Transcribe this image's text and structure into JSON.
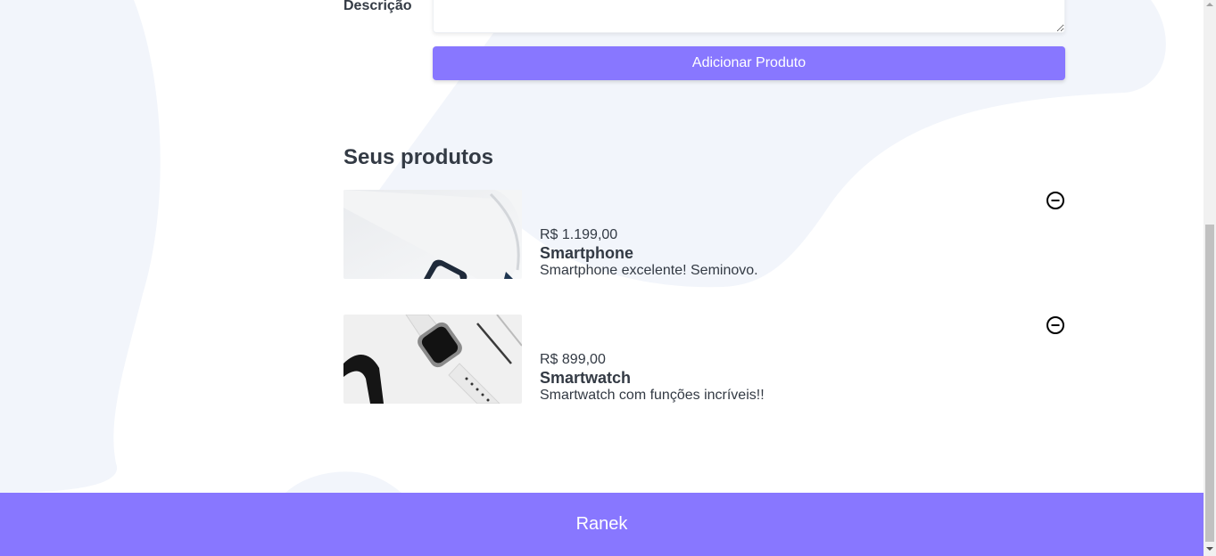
{
  "form": {
    "description_label": "Descrição",
    "description_value": "",
    "submit_label": "Adicionar Produto"
  },
  "products_section": {
    "title": "Seus produtos",
    "items": [
      {
        "price": "R$ 1.199,00",
        "name": "Smartphone",
        "description": "Smartphone excelente! Seminovo.",
        "image_icon": "smartphone-photo",
        "remove_icon": "remove-circle-icon"
      },
      {
        "price": "R$ 899,00",
        "name": "Smartwatch",
        "description": "Smartwatch com funções incríveis!!",
        "image_icon": "smartwatch-photo",
        "remove_icon": "remove-circle-icon"
      }
    ]
  },
  "footer": {
    "brand": "Ranek"
  },
  "colors": {
    "accent": "#8877ff",
    "text": "#333a44",
    "background_blob": "#f2f5fb"
  }
}
